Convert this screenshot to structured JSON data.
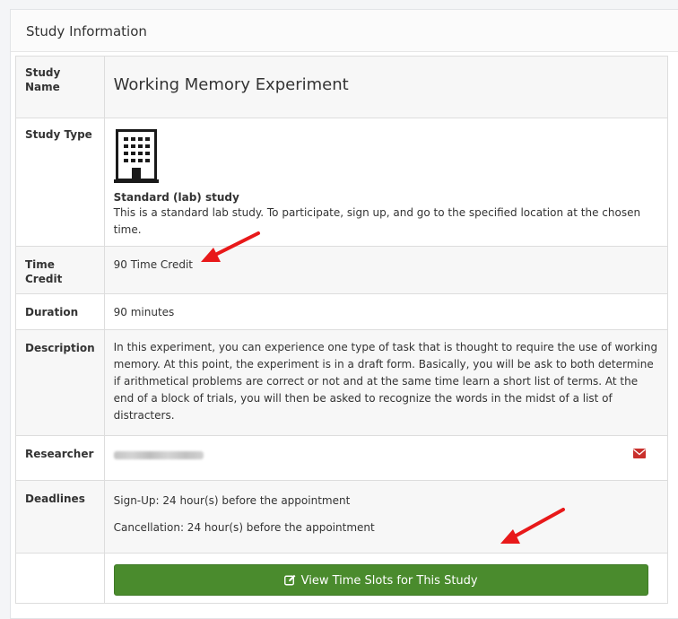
{
  "panel": {
    "title": "Study Information"
  },
  "rows": {
    "study_name": {
      "label": "Study Name",
      "value": "Working Memory Experiment"
    },
    "study_type": {
      "label": "Study Type",
      "icon": "building-icon",
      "type_title": "Standard (lab) study",
      "type_desc": "This is a standard lab study. To participate, sign up, and go to the specified location at the chosen time."
    },
    "time_credit": {
      "label": "Time Credit",
      "value": "90 Time Credit"
    },
    "duration": {
      "label": "Duration",
      "value": "90 minutes"
    },
    "description": {
      "label": "Description",
      "value": "In this experiment, you can experience one type of task that is thought to require the use of working memory. At this point, the experiment is in a draft form. Basically, you will be ask to both determine if arithmetical problems are correct or not and at the same time learn a short list of terms. At the end of a block of trials, you will then be asked to recognize the words in the midst of a list of distracters."
    },
    "researcher": {
      "label": "Researcher",
      "icon": "envelope-icon"
    },
    "deadlines": {
      "label": "Deadlines",
      "signup": "Sign-Up:  24 hour(s) before the appointment",
      "cancellation": "Cancellation:  24 hour(s) before the appointment"
    }
  },
  "actions": {
    "view_slots_label": "View Time Slots for This Study",
    "view_slots_icon": "edit-icon"
  },
  "colors": {
    "accent_green": "#4a8b2d",
    "arrow_red": "#e8191a",
    "mail_red": "#c9302c"
  }
}
